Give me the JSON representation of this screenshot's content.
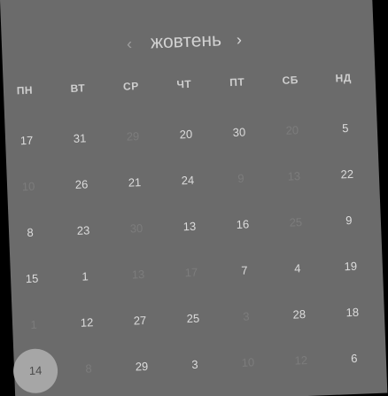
{
  "calendar": {
    "month": "жовтень",
    "prev_icon": "chevron-left-icon",
    "next_icon": "chevron-right-icon",
    "prev_glyph": "‹",
    "next_glyph": "›",
    "weekdays": [
      "ПН",
      "ВТ",
      "СР",
      "ЧТ",
      "ПТ",
      "СБ",
      "НД"
    ],
    "colors": {
      "background": "#6b6b6b",
      "day_text": "#dcdcdc",
      "dim_text": "#7c7c7c",
      "selected_circle": "#a6a6a6"
    },
    "weeks": [
      [
        {
          "n": "17"
        },
        {
          "n": "31"
        },
        {
          "n": "29",
          "dim": true
        },
        {
          "n": "20"
        },
        {
          "n": "30"
        },
        {
          "n": "20",
          "dim": true
        },
        {
          "n": "5"
        }
      ],
      [
        {
          "n": "10",
          "dim": true
        },
        {
          "n": "26"
        },
        {
          "n": "21"
        },
        {
          "n": "24"
        },
        {
          "n": "9",
          "dim": true
        },
        {
          "n": "13",
          "dim": true
        },
        {
          "n": "22"
        }
      ],
      [
        {
          "n": "8"
        },
        {
          "n": "23"
        },
        {
          "n": "30",
          "dim": true
        },
        {
          "n": "13"
        },
        {
          "n": "16"
        },
        {
          "n": "25",
          "dim": true
        },
        {
          "n": "9"
        }
      ],
      [
        {
          "n": "15"
        },
        {
          "n": "1"
        },
        {
          "n": "13",
          "dim": true
        },
        {
          "n": "17",
          "dim": true
        },
        {
          "n": "7"
        },
        {
          "n": "4"
        },
        {
          "n": "19"
        }
      ],
      [
        {
          "n": "1",
          "dim": true
        },
        {
          "n": "12"
        },
        {
          "n": "27"
        },
        {
          "n": "25"
        },
        {
          "n": "3",
          "dim": true
        },
        {
          "n": "28"
        },
        {
          "n": "18"
        }
      ],
      [
        {
          "n": "14",
          "selected": true
        },
        {
          "n": "8",
          "dim": true
        },
        {
          "n": "29"
        },
        {
          "n": "3"
        },
        {
          "n": "10",
          "dim": true
        },
        {
          "n": "12",
          "dim": true
        },
        {
          "n": "6"
        }
      ]
    ]
  }
}
